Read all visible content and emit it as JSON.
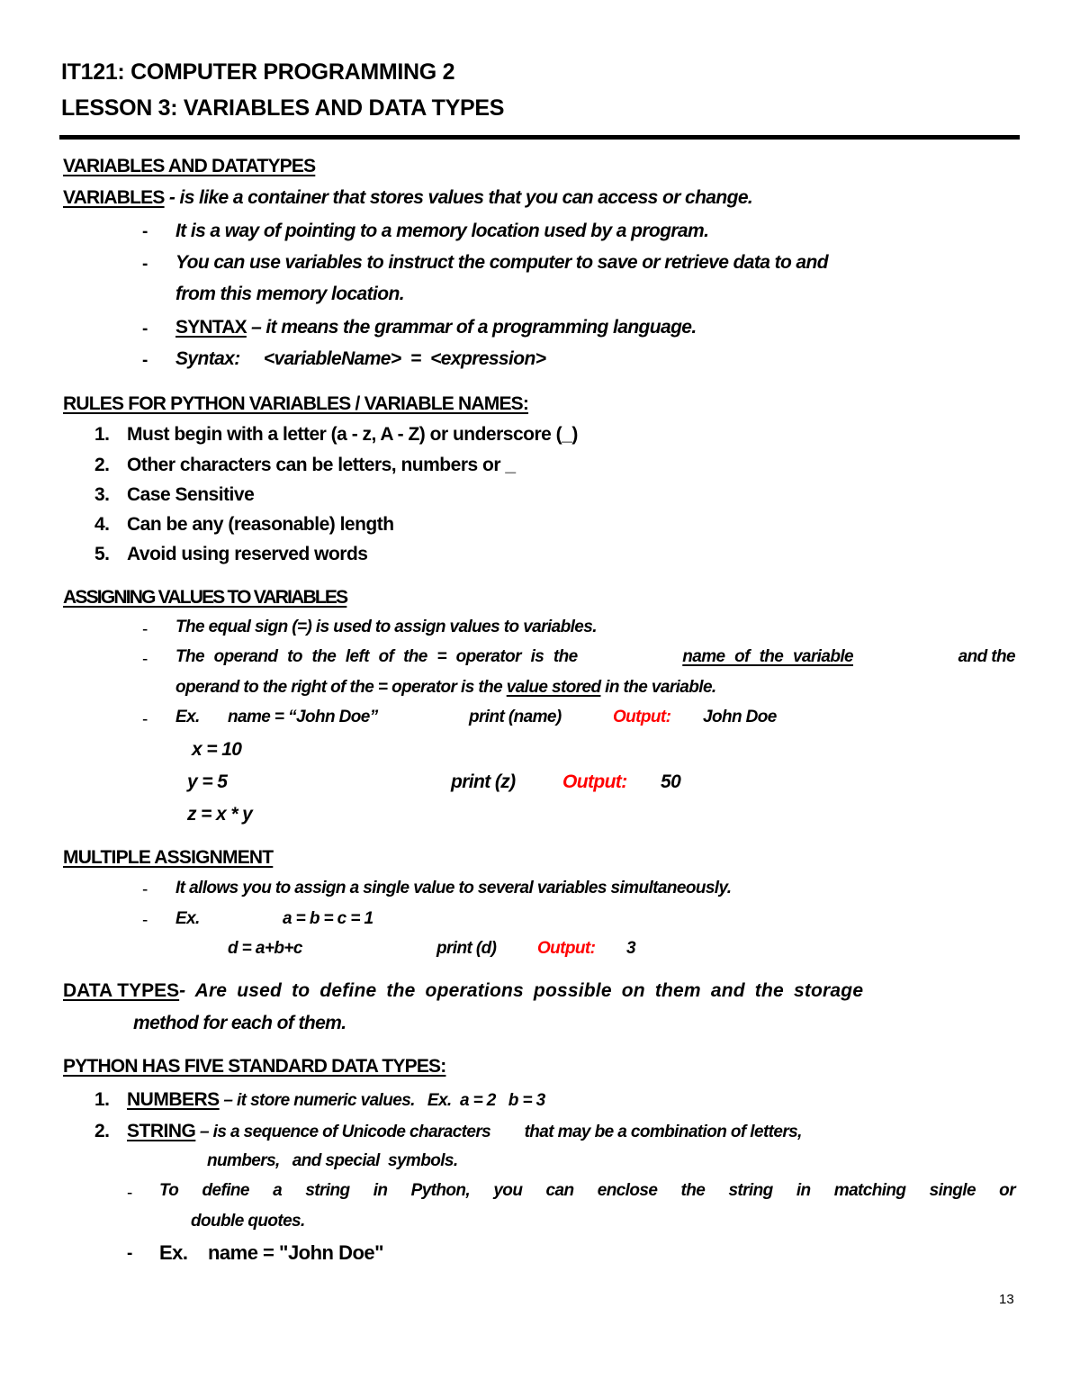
{
  "header": {
    "course": "IT121: COMPUTER PROGRAMMING 2",
    "lesson": "LESSON 3: VARIABLES AND DATA TYPES"
  },
  "section_variables": {
    "heading": "VARIABLES AND  DATATYPES",
    "term": "VARIABLES",
    "definition": " - is like a container that stores values that you can access or change.",
    "bullets": [
      "It is a    way of pointing to a memory location used by a program.",
      "You can use variables to instruct the computer to save or retrieve data to and",
      "from this memory location."
    ],
    "syntax_term": "SYNTAX",
    "syntax_def": " – it means the grammar of a programming language.",
    "syntax_line": "Syntax:     <variableName>  =  <expression>",
    "dash": "-"
  },
  "section_rules": {
    "heading": "RULES FOR PYTHON VARIABLES / VARIABLE NAMES:",
    "items": [
      {
        "num": "1.",
        "text": "Must begin with a letter (a - z, A - Z) or underscore (_)"
      },
      {
        "num": "2.",
        "text": "Other characters can be letters, numbers or _"
      },
      {
        "num": "3.",
        "text": "Case Sensitive"
      },
      {
        "num": "4.",
        "text": "Can be any (reasonable) length"
      },
      {
        "num": "5.",
        "text": "Avoid using reserved words"
      }
    ]
  },
  "section_assigning": {
    "heading": "ASSIGNING VALUES TO VARIABLES",
    "bullet1": "The equal sign (=) is used to assign values to variables.",
    "bullet2_pre": "The operand to the left of the = operator is the ",
    "bullet2_u1": "name of the variable ",
    "bullet2_post": "and the",
    "bullet2_line2_pre": "operand to the right of the = operator is the ",
    "bullet2_u2": "value stored",
    "bullet2_line2_post": " in the variable.",
    "ex_label": "Ex.",
    "ex1_code": "name = “John Doe”",
    "ex1_print": "print (name)",
    "output_label": "Output:",
    "ex1_output": "John Doe",
    "code_x": "x = 10",
    "code_y": "y = 5",
    "code_z": "z = x * y",
    "ex2_print": "print (z)",
    "ex2_output": "50"
  },
  "section_multiple": {
    "heading": "MULTIPLE ASSIGNMENT",
    "bullet1": "It allows you to assign a single value to several variables simultaneously.",
    "ex_label": "Ex.",
    "code1": "a = b = c = 1",
    "code2": "d = a+b+c",
    "print": "print (d)",
    "output_label": "Output:",
    "output": "3"
  },
  "section_datatypes": {
    "term": "DATA TYPES",
    "definition_line1": " - Are used to define the operations possible on them and the storage",
    "definition_line2": "method for each of them."
  },
  "section_standard": {
    "heading": "PYTHON HAS FIVE STANDARD DATA TYPES:",
    "item1_num": "1.",
    "item1_term": "NUMBERS",
    "item1_def": " – it store numeric values.   Ex.  a = 2   b = 3",
    "item2_num": "2.",
    "item2_term": "STRING",
    "item2_def": " – is a sequence of Unicode characters        that may be a combination of letters,",
    "item2_line2": "numbers,   and special  symbols.",
    "sub1_line1": "To define a string in Python, you can enclose the string in matching single or",
    "sub1_line2": "double quotes.",
    "sub2": "Ex.    name = \"John Doe\""
  },
  "footer": {
    "page_number": "13"
  }
}
